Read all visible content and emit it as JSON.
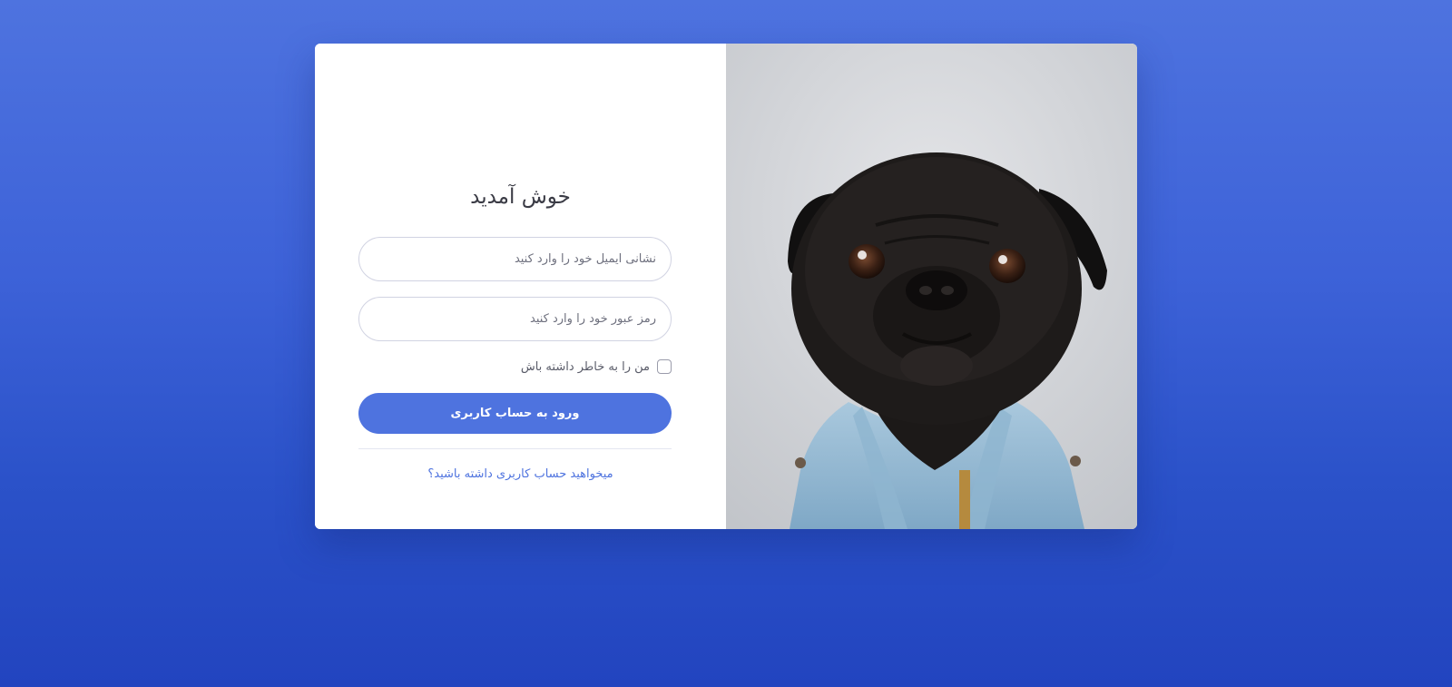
{
  "login": {
    "title": "خوش آمدید",
    "email_placeholder": "نشانی ایمیل خود را وارد کنید",
    "email_value": "",
    "password_placeholder": "رمز عبور خود را وارد کنید",
    "password_value": "",
    "remember_label": "من را به خاطر داشته باش",
    "remember_checked": false,
    "submit_label": "ورود به حساب کاربری",
    "register_link": "میخواهید حساب کاربری داشته باشید؟"
  },
  "colors": {
    "background": "#4e73df",
    "primary": "#4e73df",
    "card": "#ffffff",
    "text": "#3a3b45"
  },
  "icons": {
    "dog_photo": "pug-dog-image"
  }
}
